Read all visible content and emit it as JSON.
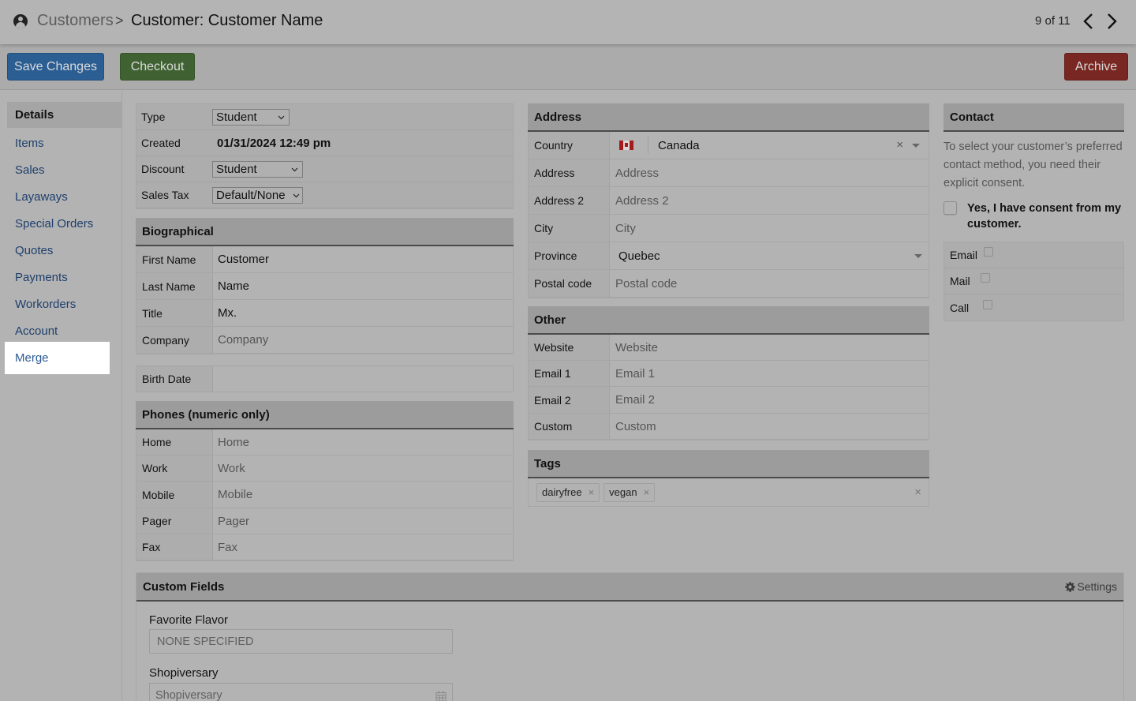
{
  "header": {
    "breadcrumb_root": "Customers",
    "breadcrumb_separator": ">",
    "breadcrumb_current": "Customer:  Customer Name",
    "pager": "9 of 11"
  },
  "toolbar": {
    "save_label": "Save Changes",
    "checkout_label": "Checkout",
    "archive_label": "Archive",
    "colors": {
      "save": "#2b5e93",
      "checkout": "#406232",
      "archive": "#782722"
    }
  },
  "sidebar": {
    "items": [
      {
        "label": "Details",
        "state": "active"
      },
      {
        "label": "Items"
      },
      {
        "label": "Sales"
      },
      {
        "label": "Layaways"
      },
      {
        "label": "Special Orders"
      },
      {
        "label": "Quotes"
      },
      {
        "label": "Payments"
      },
      {
        "label": "Workorders"
      },
      {
        "label": "Account"
      },
      {
        "label": "Merge",
        "state": "hover"
      }
    ]
  },
  "basic": {
    "type_label": "Type",
    "type_value": "Student",
    "created_label": "Created",
    "created_value": "01/31/2024 12:49 pm",
    "discount_label": "Discount",
    "discount_value": "Student",
    "tax_label": "Sales Tax",
    "tax_value": "Default/None"
  },
  "bio": {
    "title": "Biographical",
    "rows": [
      {
        "label": "First Name",
        "value": "Customer",
        "placeholder": false
      },
      {
        "label": "Last Name",
        "value": "Name",
        "placeholder": false
      },
      {
        "label": "Title",
        "value": "Mx.",
        "placeholder": false
      },
      {
        "label": "Company",
        "value": "Company",
        "placeholder": true
      }
    ],
    "birth_label": "Birth Date",
    "birth_value": ""
  },
  "phones": {
    "title": "Phones (numeric only)",
    "rows": [
      {
        "label": "Home",
        "placeholder": "Home"
      },
      {
        "label": "Work",
        "placeholder": "Work"
      },
      {
        "label": "Mobile",
        "placeholder": "Mobile"
      },
      {
        "label": "Pager",
        "placeholder": "Pager"
      },
      {
        "label": "Fax",
        "placeholder": "Fax"
      }
    ]
  },
  "address": {
    "title": "Address",
    "country_label": "Country",
    "country_value": "Canada",
    "address_label": "Address",
    "address_placeholder": "Address",
    "address2_label": "Address 2",
    "address2_placeholder": "Address 2",
    "city_label": "City",
    "city_placeholder": "City",
    "province_label": "Province",
    "province_value": "Quebec",
    "postal_label": "Postal code",
    "postal_placeholder": "Postal code"
  },
  "other": {
    "title": "Other",
    "rows": [
      {
        "label": "Website",
        "placeholder": "Website"
      },
      {
        "label": "Email 1",
        "placeholder": "Email 1"
      },
      {
        "label": "Email 2",
        "placeholder": "Email 2"
      },
      {
        "label": "Custom",
        "placeholder": "Custom"
      }
    ]
  },
  "tags": {
    "title": "Tags",
    "items": [
      "dairyfree",
      "vegan"
    ],
    "remove_glyph": "×"
  },
  "contact": {
    "title": "Contact",
    "description": "To select your customer’s preferred contact method, you need their explicit consent.",
    "consent_label": "Yes, I have consent from my customer.",
    "consent_checked": false,
    "methods": [
      {
        "label": "Email",
        "checked": false
      },
      {
        "label": "Mail",
        "checked": false
      },
      {
        "label": "Call",
        "checked": false
      }
    ]
  },
  "custom_fields": {
    "title": "Custom Fields",
    "settings_label": "Settings",
    "fields": [
      {
        "label": "Favorite Flavor",
        "value": "NONE SPECIFIED"
      },
      {
        "label": "Shopiversary",
        "placeholder": "Shopiversary"
      }
    ]
  }
}
